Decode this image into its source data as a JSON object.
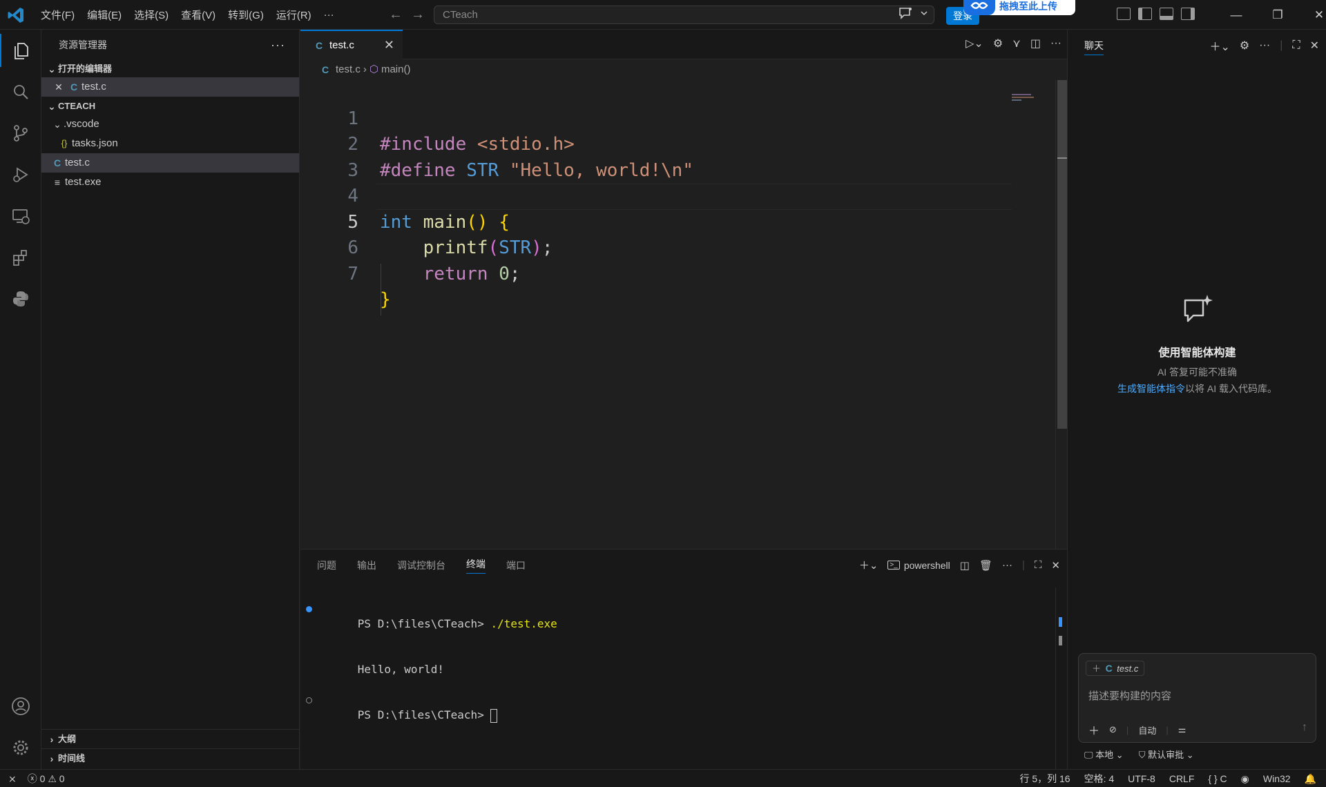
{
  "titlebar": {
    "menu": [
      "文件(F)",
      "编辑(E)",
      "选择(S)",
      "查看(V)",
      "转到(G)",
      "运行(R)",
      "···"
    ],
    "search_text": "CTeach",
    "login_label": "登录",
    "upload_banner": "拖拽至此上传"
  },
  "sidebar": {
    "title": "资源管理器",
    "more": "···",
    "open_editors_section": "打开的编辑器",
    "open_editors": [
      {
        "name": "test.c"
      }
    ],
    "project_section": "CTEACH",
    "tree": [
      {
        "name": ".vscode",
        "type": "folder"
      },
      {
        "name": "tasks.json",
        "type": "json"
      },
      {
        "name": "test.c",
        "type": "c"
      },
      {
        "name": "test.exe",
        "type": "file"
      }
    ],
    "outline_section": "大纲",
    "timeline_section": "时间线"
  },
  "editor": {
    "tab_label": "test.c",
    "breadcrumb_file": "test.c",
    "breadcrumb_symbol": "main()",
    "line_numbers": [
      "1",
      "2",
      "3",
      "4",
      "5",
      "6",
      "7"
    ],
    "current_line": 5,
    "code_lines": [
      "#include <stdio.h>",
      "#define STR \"Hello, world!\\n\"",
      "",
      "int main() {",
      "    printf(STR);",
      "    return 0;",
      "}"
    ]
  },
  "panel": {
    "tabs": [
      "问题",
      "输出",
      "调试控制台",
      "终端",
      "端口"
    ],
    "active_tab": "终端",
    "shell_label": "powershell",
    "terminal": [
      {
        "prompt": "PS D:\\files\\CTeach> ",
        "cmd": "./test.exe",
        "dot": "#3794ff"
      },
      {
        "prompt": "Hello, world!",
        "cmd": "",
        "dot": ""
      },
      {
        "prompt": "PS D:\\files\\CTeach> ",
        "cmd": "",
        "dot": "hollow"
      }
    ]
  },
  "chat": {
    "title": "聊天",
    "heading": "使用智能体构建",
    "disclaimer": "AI 答复可能不准确",
    "link_text": "生成智能体指令",
    "link_suffix": "以将 AI 载入代码库。",
    "context_chip": "test.c",
    "input_placeholder": "描述要构建的内容",
    "mode_label": "自动",
    "footer_local": "本地",
    "footer_approval": "默认审批"
  },
  "statusbar": {
    "errors": "0",
    "warnings": "0",
    "position": "行 5，列 16",
    "spaces": "空格: 4",
    "encoding": "UTF-8",
    "eol": "CRLF",
    "language": "C",
    "platform": "Win32"
  },
  "colors": {
    "accent": "#0078d4",
    "background": "#1f1f1f",
    "sidebar": "#181818"
  }
}
